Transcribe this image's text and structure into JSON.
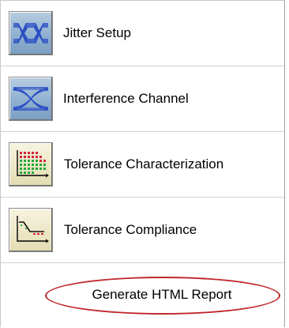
{
  "menu": {
    "items": [
      {
        "label": "Jitter Setup",
        "icon": "eye-diagram-icon"
      },
      {
        "label": "Interference Channel",
        "icon": "interference-eye-icon"
      },
      {
        "label": "Tolerance Characterization",
        "icon": "tolerance-grid-chart-icon"
      },
      {
        "label": "Tolerance Compliance",
        "icon": "compliance-curve-chart-icon"
      }
    ],
    "report_label": "Generate HTML Report"
  },
  "colors": {
    "highlight_ellipse": "#c0262b",
    "icon_blue": "#8fb0cf",
    "icon_beige": "#ece6c4"
  }
}
